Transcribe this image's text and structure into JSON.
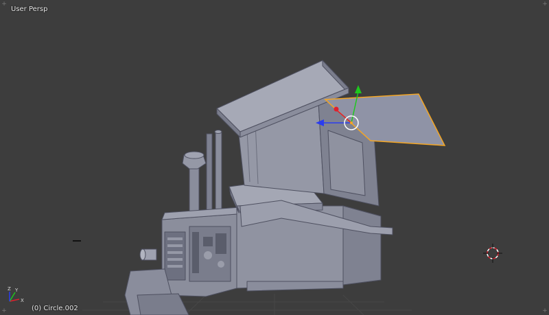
{
  "viewport": {
    "view_label": "User Persp",
    "object_label": "(0) Circle.002"
  },
  "icons": {
    "corner_widget": "plus-icon",
    "cursor_3d": "crosshair-icon",
    "axes": "axis-gizmo-icon",
    "transform_manipulator": "translate-manipulator-icon"
  },
  "colors": {
    "background": "#3d3d3d",
    "model": "#8a8d9c",
    "selection": "#f5a623",
    "axis_x": "#e0202e",
    "axis_y": "#1ec81e",
    "axis_z": "#2a3cf0"
  },
  "axes_labels": {
    "x": "X",
    "y": "Y",
    "z": "Z"
  }
}
